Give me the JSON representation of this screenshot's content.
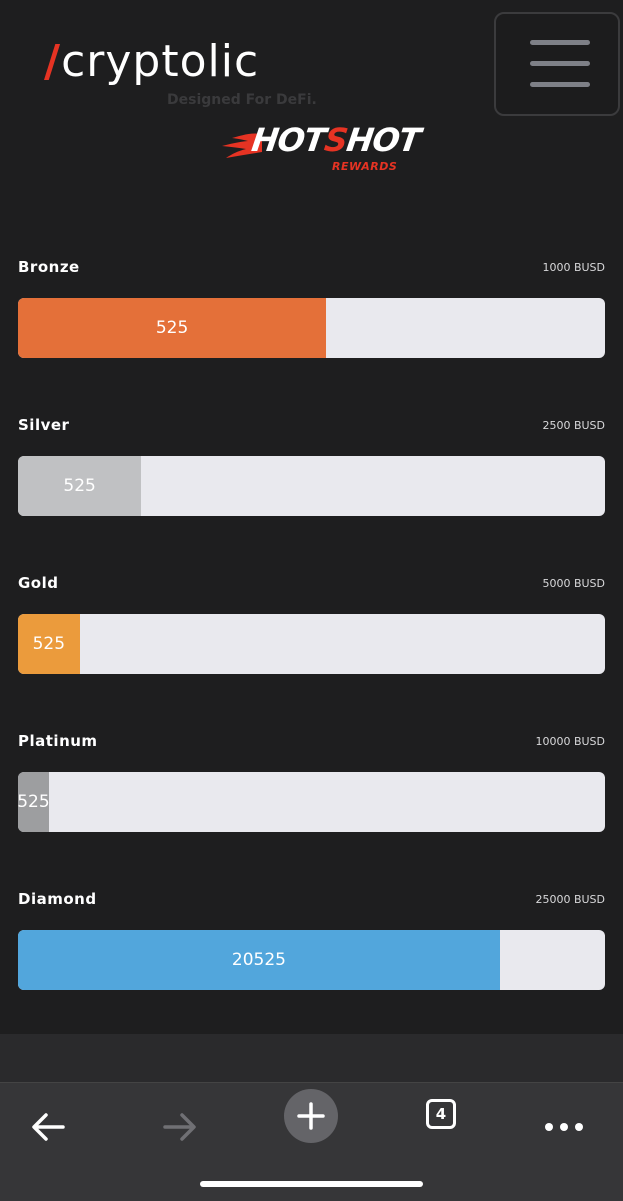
{
  "header": {
    "logo_slash": "/",
    "logo_name": "cryptolic",
    "logo_tagline": "Designed For DeFi.",
    "menu_icon": "hamburger-menu-icon",
    "rewards_logo": {
      "part1": "HOT",
      "part2": "S",
      "part3": "HOT",
      "sub": "REWARDS"
    }
  },
  "tiers": [
    {
      "name": "Bronze",
      "goal": "1000 BUSD",
      "value": "525",
      "progress": 0.525,
      "color": "#e47039"
    },
    {
      "name": "Silver",
      "goal": "2500 BUSD",
      "value": "525",
      "progress": 0.21,
      "color": "#c0c1c3"
    },
    {
      "name": "Gold",
      "goal": "5000 BUSD",
      "value": "525",
      "progress": 0.105,
      "color": "#eb9b3c"
    },
    {
      "name": "Platinum",
      "goal": "10000 BUSD",
      "value": "525",
      "progress": 0.0525,
      "color": "#9d9e a0"
    },
    {
      "name": "Diamond",
      "goal": "25000 BUSD",
      "value": "20525",
      "progress": 0.821,
      "color": "#52a6dc"
    }
  ],
  "browser_toolbar": {
    "back_icon": "back-arrow-icon",
    "forward_icon": "forward-arrow-icon",
    "new_tab_icon": "plus-icon",
    "tab_count": "4",
    "more_icon": "more-dots-icon"
  },
  "colors": {
    "background": "#1e1e1f",
    "track": "#e9e9ee",
    "brand_red": "#e63323"
  }
}
